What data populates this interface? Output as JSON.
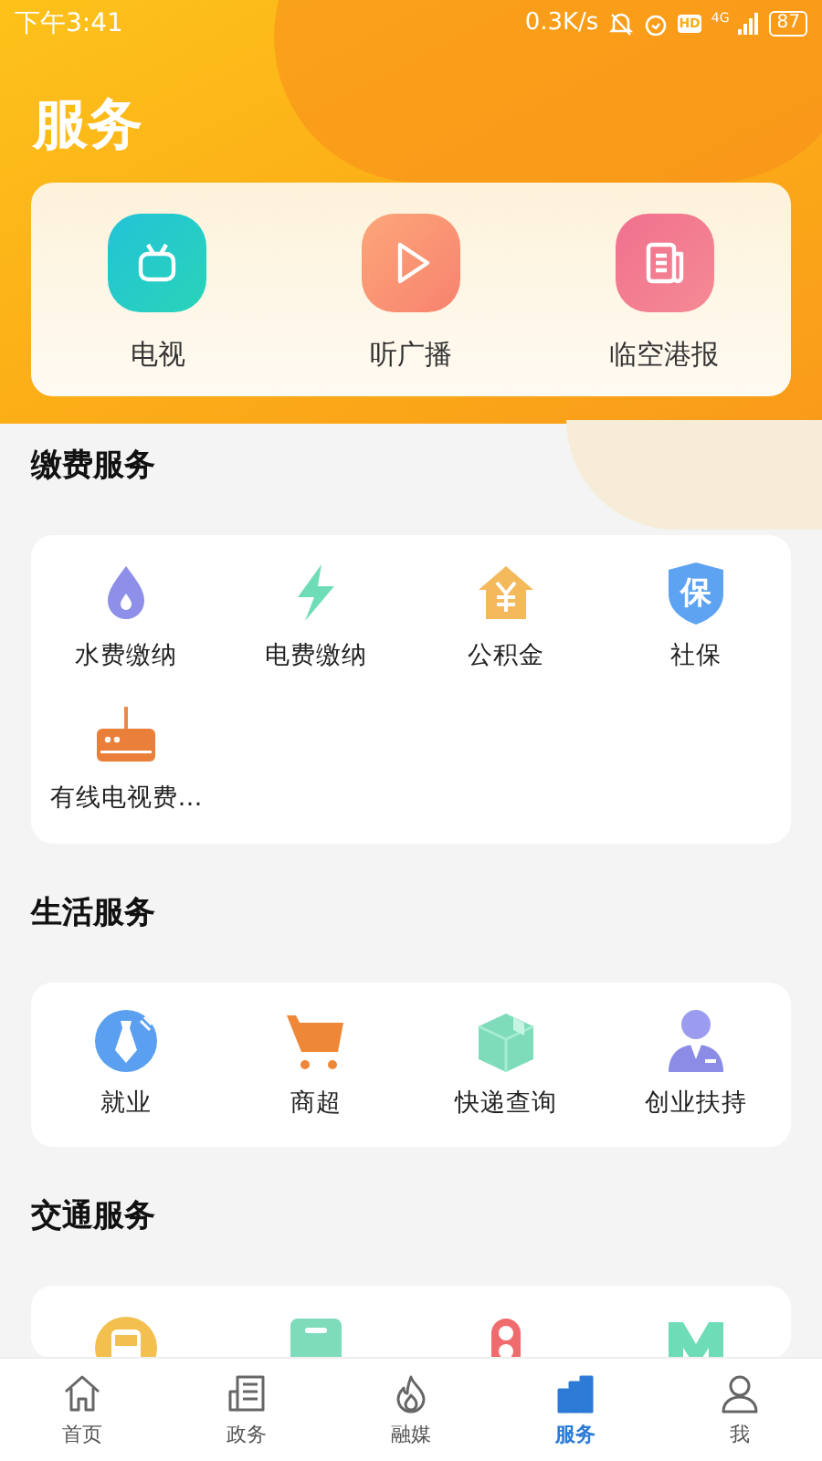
{
  "status_bar": {
    "time": "下午3:41",
    "speed": "0.3K/s",
    "hd": "HD",
    "network": "4G",
    "battery": "87"
  },
  "header": {
    "title": "服务"
  },
  "quick_links": [
    {
      "label": "电视",
      "kind": "tv"
    },
    {
      "label": "听广播",
      "kind": "radio"
    },
    {
      "label": "临空港报",
      "kind": "paper"
    }
  ],
  "sections": [
    {
      "title": "缴费服务",
      "items": [
        {
          "label": "水费缴纳",
          "kind": "water"
        },
        {
          "label": "电费缴纳",
          "kind": "power"
        },
        {
          "label": "公积金",
          "kind": "fund"
        },
        {
          "label": "社保",
          "kind": "insurance",
          "glyph": "保"
        },
        {
          "label": "有线电视费…",
          "kind": "router"
        }
      ]
    },
    {
      "title": "生活服务",
      "items": [
        {
          "label": "就业",
          "kind": "job"
        },
        {
          "label": "商超",
          "kind": "cart"
        },
        {
          "label": "快递查询",
          "kind": "parcel"
        },
        {
          "label": "创业扶持",
          "kind": "person"
        }
      ]
    },
    {
      "title": "交通服务",
      "items": [
        {
          "kind": "bus"
        },
        {
          "kind": "card"
        },
        {
          "kind": "light"
        },
        {
          "kind": "metro"
        }
      ]
    }
  ],
  "tabs": [
    {
      "label": "首页",
      "kind": "home",
      "selected": false
    },
    {
      "label": "政务",
      "kind": "news",
      "selected": false
    },
    {
      "label": "融媒",
      "kind": "fire",
      "selected": false
    },
    {
      "label": "服务",
      "kind": "service",
      "selected": true
    },
    {
      "label": "我",
      "kind": "me",
      "selected": false
    }
  ]
}
